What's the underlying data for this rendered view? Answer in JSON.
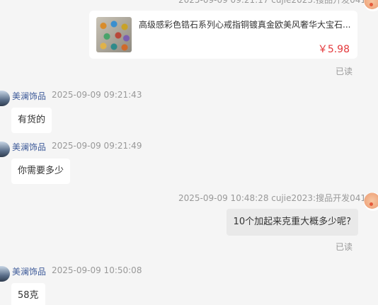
{
  "top": {
    "meta_partial": "2025-09-09 09:21:17   cujie2023:搜品开发041"
  },
  "product": {
    "title": "高级感彩色锆石系列心戒指铜镀真金欧美风奢华大宝石...",
    "price": "￥5.98",
    "read_status": "已读"
  },
  "messages": [
    {
      "side": "left",
      "sender": "美澜饰品",
      "time": "2025-09-09 09:21:43",
      "text": "有货的"
    },
    {
      "side": "left",
      "sender": "美澜饰品",
      "time": "2025-09-09 09:21:49",
      "text": "你需要多少"
    },
    {
      "side": "right",
      "meta": "2025-09-09 10:48:28   cujie2023:搜品开发041",
      "text": "10个加起来克重大概多少呢?",
      "read_status": "已读"
    },
    {
      "side": "left",
      "sender": "美澜饰品",
      "time": "2025-09-09 10:50:08",
      "text": "58克"
    }
  ],
  "icons": {
    "right_avatar": "user-avatar-icon",
    "left_avatar": "shop-avatar-icon",
    "product_image": "ring-product-image"
  }
}
